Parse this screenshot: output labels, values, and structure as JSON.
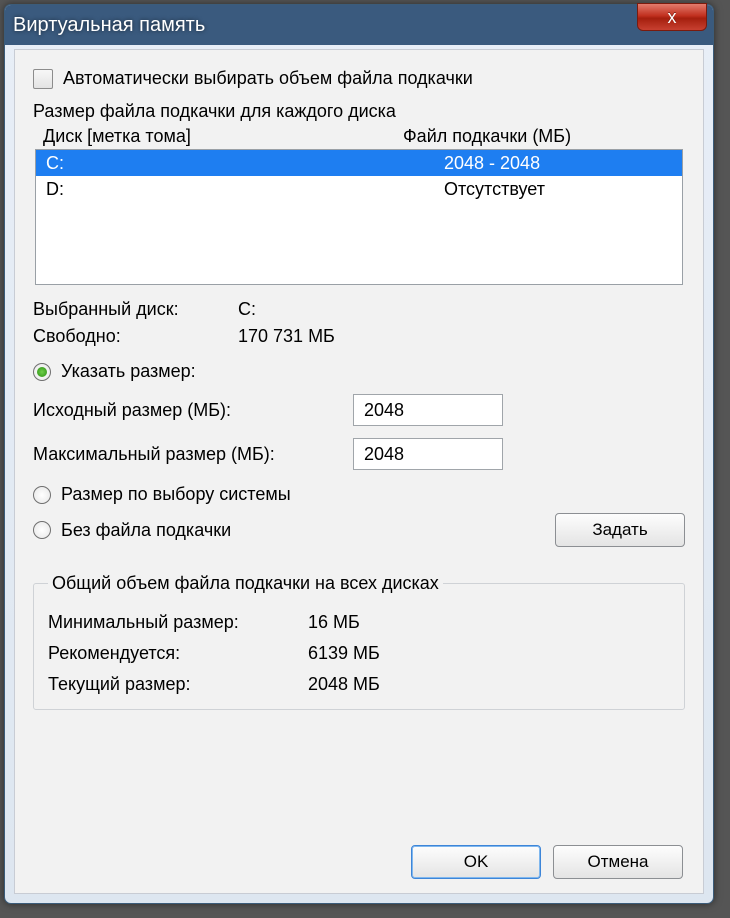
{
  "window": {
    "title": "Виртуальная память",
    "close_icon": "x"
  },
  "auto": {
    "label": "Автоматически выбирать объем файла подкачки",
    "checked": false
  },
  "group1": {
    "title": "Размер файла подкачки для каждого диска",
    "col_drive": "Диск [метка тома]",
    "col_pf": "Файл подкачки (МБ)",
    "rows": [
      {
        "drive": "C:",
        "pf": "2048 - 2048",
        "selected": true
      },
      {
        "drive": "D:",
        "pf": "Отсутствует",
        "selected": false
      }
    ]
  },
  "selected": {
    "drive_label": "Выбранный диск:",
    "drive_value": "C:",
    "free_label": "Свободно:",
    "free_value": "170 731 МБ"
  },
  "radios": {
    "custom": "Указать размер:",
    "system": "Размер по выбору системы",
    "none": "Без файла подкачки"
  },
  "size": {
    "initial_label": "Исходный размер (МБ):",
    "initial_value": "2048",
    "max_label": "Максимальный размер (МБ):",
    "max_value": "2048"
  },
  "buttons": {
    "set": "Задать",
    "ok": "OK",
    "cancel": "Отмена"
  },
  "summary": {
    "title": "Общий объем файла подкачки на всех дисках",
    "min_label": "Минимальный размер:",
    "min_value": "16 МБ",
    "rec_label": "Рекомендуется:",
    "rec_value": "6139 МБ",
    "cur_label": "Текущий размер:",
    "cur_value": "2048 МБ"
  }
}
